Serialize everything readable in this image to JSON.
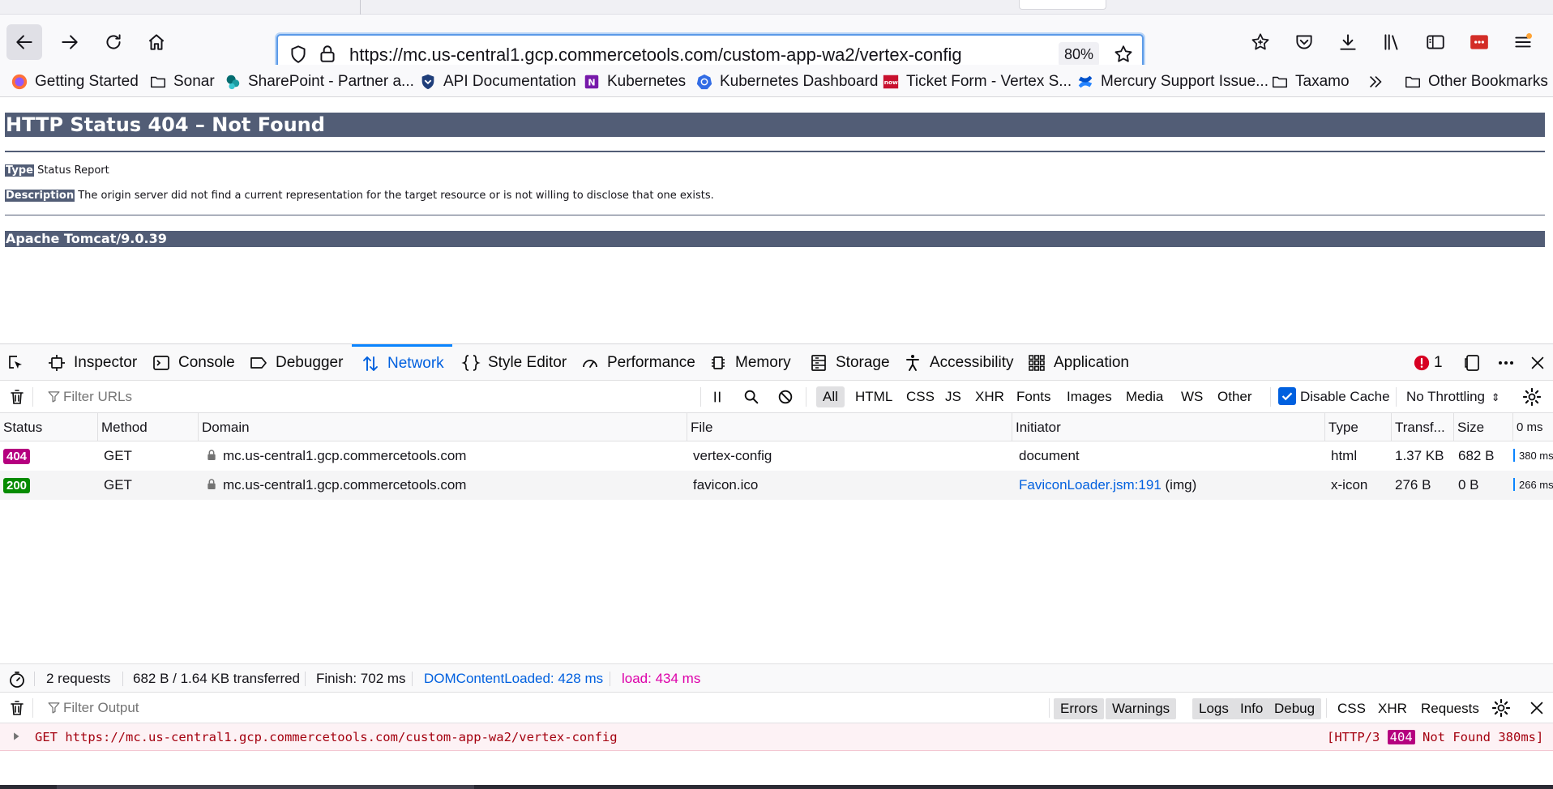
{
  "browser": {
    "url": "https://mc.us-central1.gcp.commercetools.com/custom-app-wa2/vertex-config",
    "zoom": "80%",
    "bookmarks": [
      {
        "label": "Getting Started",
        "icon": "firefox-icon"
      },
      {
        "label": "Sonar",
        "icon": "folder-icon"
      },
      {
        "label": "SharePoint - Partner a...",
        "icon": "sharepoint-icon"
      },
      {
        "label": "API Documentation",
        "icon": "shield-icon"
      },
      {
        "label": "Kubernetes",
        "icon": "onenote-icon"
      },
      {
        "label": "Kubernetes Dashboard",
        "icon": "kubernetes-icon"
      },
      {
        "label": "Ticket Form - Vertex S...",
        "icon": "servicenow-icon"
      },
      {
        "label": "Mercury Support Issue...",
        "icon": "confluence-icon"
      },
      {
        "label": "Taxamo",
        "icon": "folder-icon"
      },
      {
        "label": "Other Bookmarks",
        "icon": "folder-icon"
      }
    ]
  },
  "page": {
    "title": "HTTP Status 404 – Not Found",
    "type_label": "Type",
    "type_value": "Status Report",
    "description_label": "Description",
    "description_value": "The origin server did not find a current representation for the target resource or is not willing to disclose that one exists.",
    "footer": "Apache Tomcat/9.0.39"
  },
  "devtools": {
    "tabs": [
      "Inspector",
      "Console",
      "Debugger",
      "Network",
      "Style Editor",
      "Performance",
      "Memory",
      "Storage",
      "Accessibility",
      "Application"
    ],
    "selected_tab": "Network",
    "error_count": "1",
    "filter_placeholder": "Filter URLs",
    "filter_types": [
      "All",
      "HTML",
      "CSS",
      "JS",
      "XHR",
      "Fonts",
      "Images",
      "Media",
      "WS",
      "Other"
    ],
    "disable_cache_label": "Disable Cache",
    "throttling": "No Throttling",
    "columns": [
      "Status",
      "Method",
      "Domain",
      "File",
      "Initiator",
      "Type",
      "Transf...",
      "Size",
      "0 ms"
    ],
    "rows": [
      {
        "status": "404",
        "status_color": "#b5007f",
        "method": "GET",
        "domain": "mc.us-central1.gcp.commercetools.com",
        "file": "vertex-config",
        "initiator": "document",
        "initiator_extra": "",
        "type": "html",
        "transferred": "1.37 KB",
        "size": "682 B",
        "timing": "380 ms"
      },
      {
        "status": "200",
        "status_color": "#058b00",
        "method": "GET",
        "domain": "mc.us-central1.gcp.commercetools.com",
        "file": "favicon.ico",
        "initiator": "FaviconLoader.jsm:191",
        "initiator_extra": "(img)",
        "type": "x-icon",
        "transferred": "276 B",
        "size": "0 B",
        "timing": "266 ms"
      }
    ],
    "summary": {
      "requests": "2 requests",
      "transferred": "682 B / 1.64 KB transferred",
      "finish": "Finish: 702 ms",
      "domcontentloaded": "DOMContentLoaded: 428 ms",
      "load": "load: 434 ms"
    },
    "console": {
      "filter_placeholder": "Filter Output",
      "levels": [
        "Errors",
        "Warnings",
        "Logs",
        "Info",
        "Debug"
      ],
      "types": [
        "CSS",
        "XHR",
        "Requests"
      ],
      "message_method": "GET",
      "message_url": "https://mc.us-central1.gcp.commercetools.com/custom-app-wa2/vertex-config",
      "message_status_prefix": "[HTTP/3",
      "message_status_code": "404",
      "message_status_suffix": "Not Found 380ms]"
    }
  },
  "colors": {
    "tomcat_bar": "#525d76",
    "accent_blue": "#0060df",
    "error_red": "#a4000f",
    "magenta": "#dd00a9"
  }
}
